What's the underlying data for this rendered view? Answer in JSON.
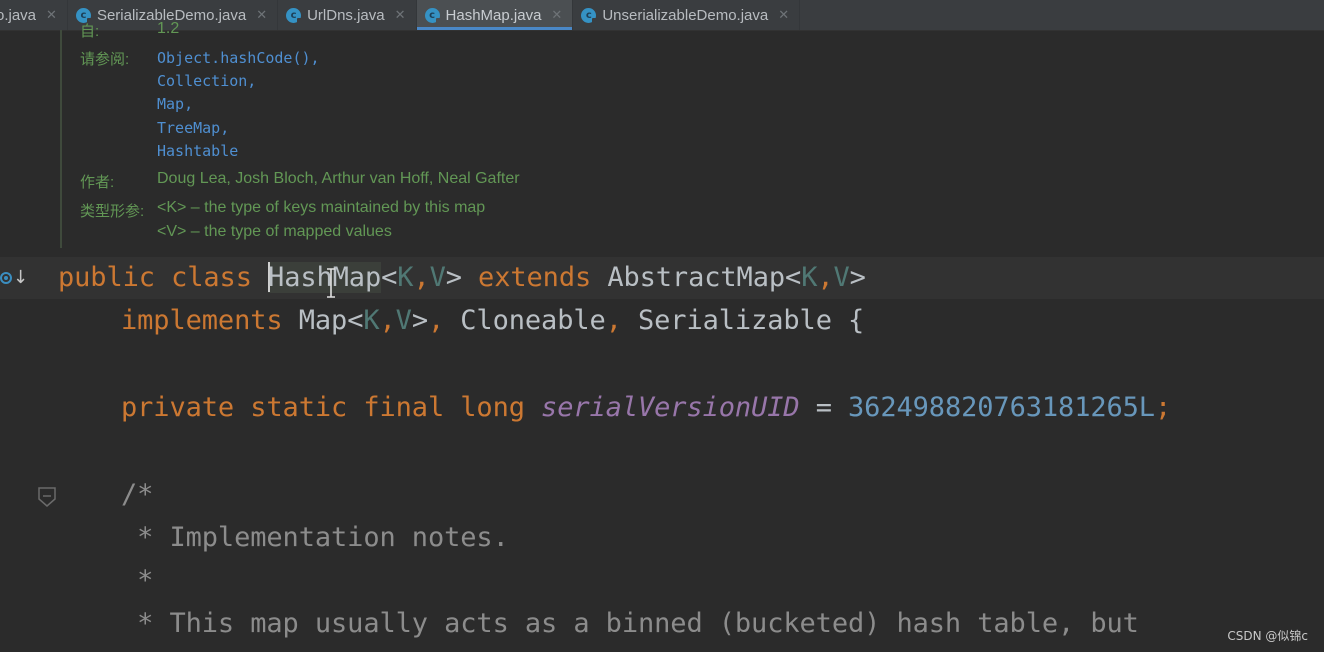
{
  "tabs": [
    {
      "label": "o.java",
      "icon": "class-icon",
      "active": false
    },
    {
      "label": "SerializableDemo.java",
      "icon": "class-icon",
      "active": false
    },
    {
      "label": "UrlDns.java",
      "icon": "class-icon",
      "active": false
    },
    {
      "label": "HashMap.java",
      "icon": "class-icon",
      "active": true
    },
    {
      "label": "UnserializableDemo.java",
      "icon": "class-icon",
      "active": false
    }
  ],
  "javadoc": {
    "partial_label": "自:",
    "partial_value": "1.2",
    "see_label": "请参阅:",
    "see_links": [
      "Object.hashCode(),",
      "Collection,",
      "Map,",
      "TreeMap,",
      "Hashtable"
    ],
    "author_label": "作者:",
    "authors": "Doug Lea, Josh Bloch, Arthur van Hoff, Neal Gafter",
    "type_params_label": "类型形参:",
    "type_param_k": "<K> – the type of keys maintained by this map",
    "type_param_v": "<V> – the type of mapped values"
  },
  "code": {
    "l1": {
      "kw1": "public class ",
      "caret_pre": "H",
      "name": "ashMap",
      "lt": "<",
      "k": "K",
      "comma": ",",
      "v": "V",
      "gt": ">",
      "ext": " extends ",
      "parent": "AbstractMap",
      "lt2": "<",
      "k2": "K",
      "comma2": ",",
      "v2": "V",
      "gt2": ">"
    },
    "l2": {
      "impl": "implements ",
      "map": "Map",
      "lt": "<",
      "k": "K",
      "comma": ",",
      "v": "V",
      "gt": ">",
      "sep1": ", ",
      "cloneable": "Cloneable",
      "sep2": ", ",
      "serializable": "Serializable",
      "brace": " {"
    },
    "l3": {
      "mods": "private static final long ",
      "field": "serialVersionUID",
      "eq": " = ",
      "num": "362498820763181265L",
      "semi": ";"
    },
    "l4": "/*",
    "l5": " * Implementation notes.",
    "l6": " *",
    "l7": " * This map usually acts as a binned (bucketed) hash table, but"
  },
  "icons": {
    "gutter": "override-method-icon",
    "fold": "fold-marker-icon"
  },
  "watermark": "CSDN @似锦c",
  "colors": {
    "background": "#2b2b2b",
    "keyword": "#cc7832",
    "javadoc": "#629755",
    "link": "#4f8fd1",
    "field": "#9876aa",
    "number": "#6897bb",
    "tab_active_underline": "#4a88c7"
  }
}
